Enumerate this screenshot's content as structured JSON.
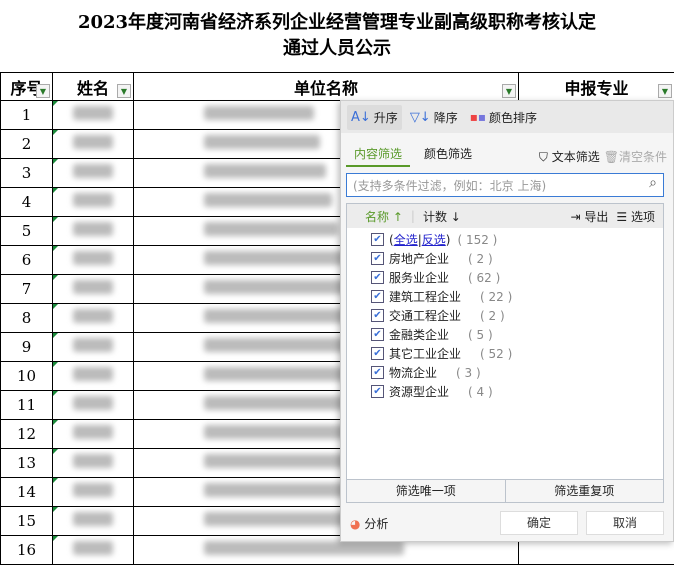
{
  "title": {
    "line1": "2023年度河南省经济系列企业经营管理专业副高级职称考核认定",
    "line2": "通过人员公示"
  },
  "table": {
    "headers": [
      "序号",
      "姓名",
      "单位名称",
      "申报专业"
    ],
    "rows": [
      "1",
      "2",
      "3",
      "4",
      "5",
      "6",
      "7",
      "8",
      "9",
      "10",
      "11",
      "12",
      "13",
      "14",
      "15",
      "16"
    ]
  },
  "filter": {
    "sort": {
      "asc": "升序",
      "desc": "降序",
      "color": "颜色排序"
    },
    "tabs": {
      "content": "内容筛选",
      "color": "颜色筛选"
    },
    "text_filter": "文本筛选",
    "clear": "清空条件",
    "search_placeholder": "(支持多条件过滤，例如：北京  上海)",
    "list_header": {
      "name": "名称",
      "count": "计数",
      "export": "导出",
      "options": "选项"
    },
    "select_all": "全选",
    "invert": "反选",
    "total": "( 152 )",
    "items": [
      {
        "label": "房地产企业",
        "count": "( 2 )"
      },
      {
        "label": "服务业企业",
        "count": "( 62 )"
      },
      {
        "label": "建筑工程企业",
        "count": "( 22 )"
      },
      {
        "label": "交通工程企业",
        "count": "( 2 )"
      },
      {
        "label": "金融类企业",
        "count": "( 5 )"
      },
      {
        "label": "其它工业企业",
        "count": "( 52 )"
      },
      {
        "label": "物流企业",
        "count": "( 3 )"
      },
      {
        "label": "资源型企业",
        "count": "( 4 )"
      }
    ],
    "unique": "筛选唯一项",
    "duplicate": "筛选重复项",
    "analysis": "分析",
    "ok": "确定",
    "cancel": "取消"
  }
}
